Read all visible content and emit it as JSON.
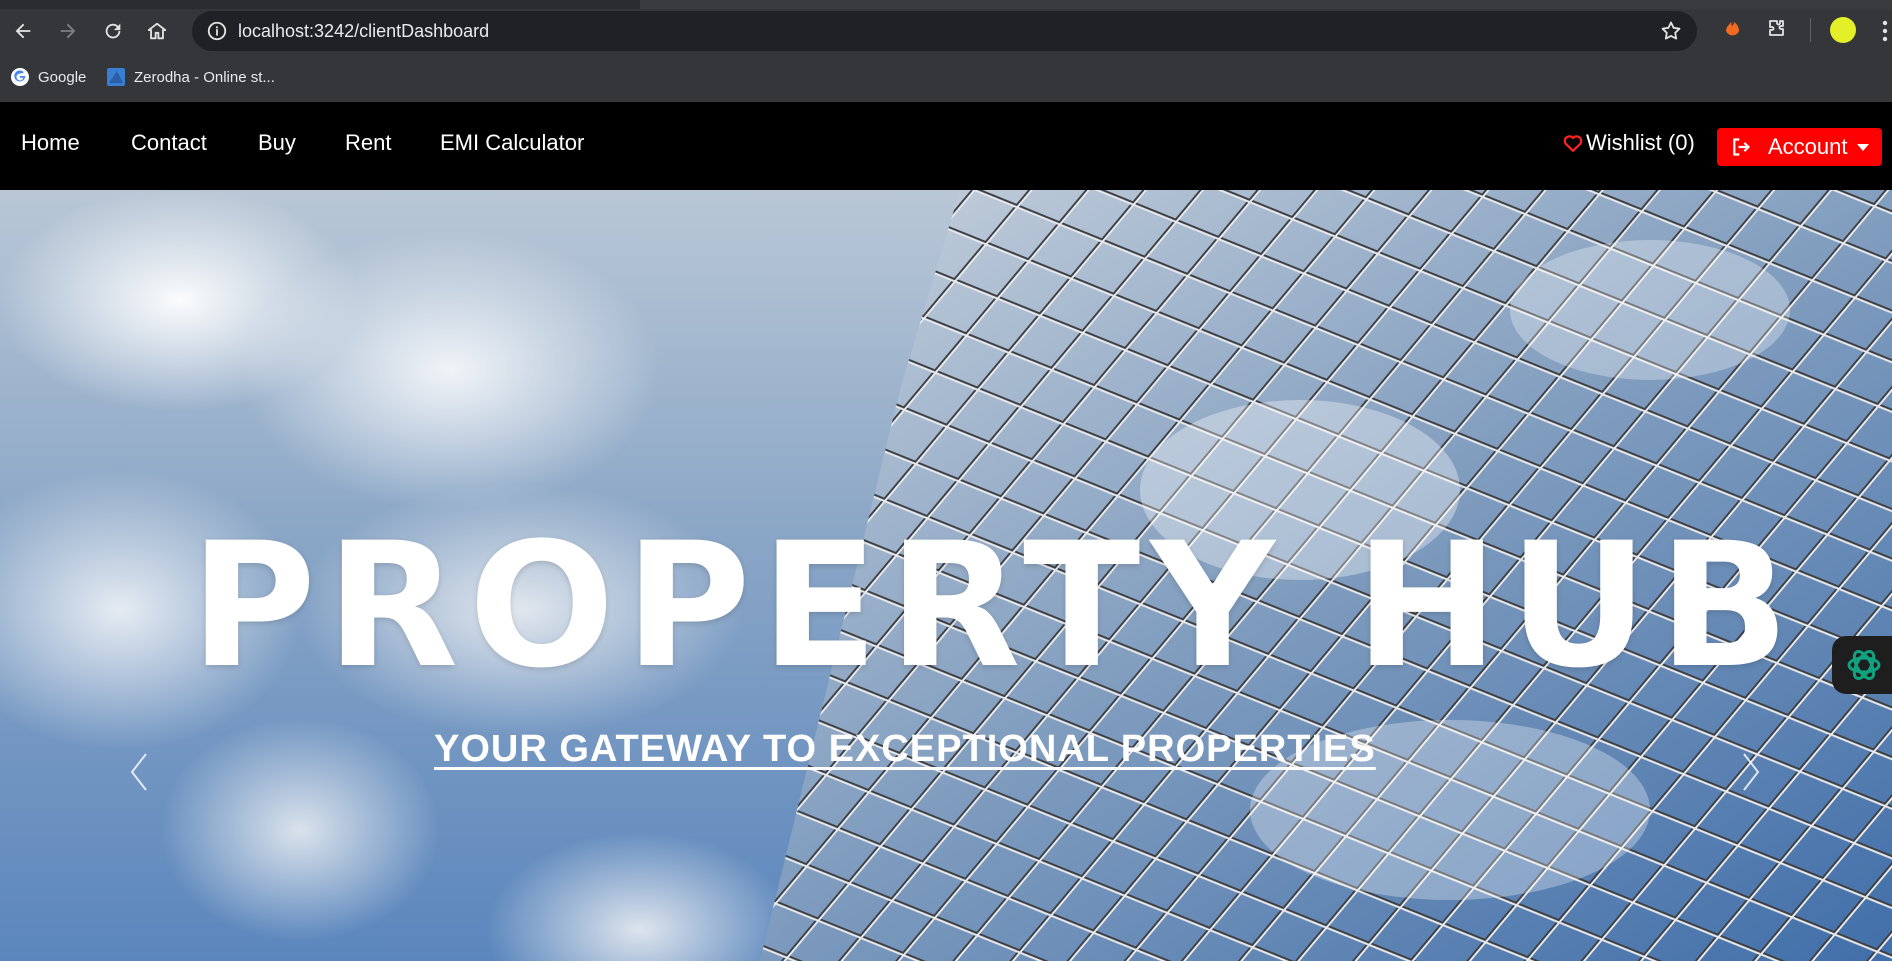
{
  "browser": {
    "url": "localhost:3242/clientDashboard",
    "bookmarks": [
      {
        "label": "Google",
        "icon": "google-icon"
      },
      {
        "label": "Zerodha - Online st...",
        "icon": "zerodha-icon"
      }
    ]
  },
  "navbar": {
    "links": [
      "Home",
      "Contact",
      "Buy",
      "Rent",
      "EMI Calculator"
    ],
    "wishlist_label": "Wishlist (0)",
    "account_label": "Account",
    "account_color": "#ff0000"
  },
  "hero": {
    "title": "PROPERTY HUB",
    "subtitle": "YOUR GATEWAY TO EXCEPTIONAL PROPERTIES"
  }
}
